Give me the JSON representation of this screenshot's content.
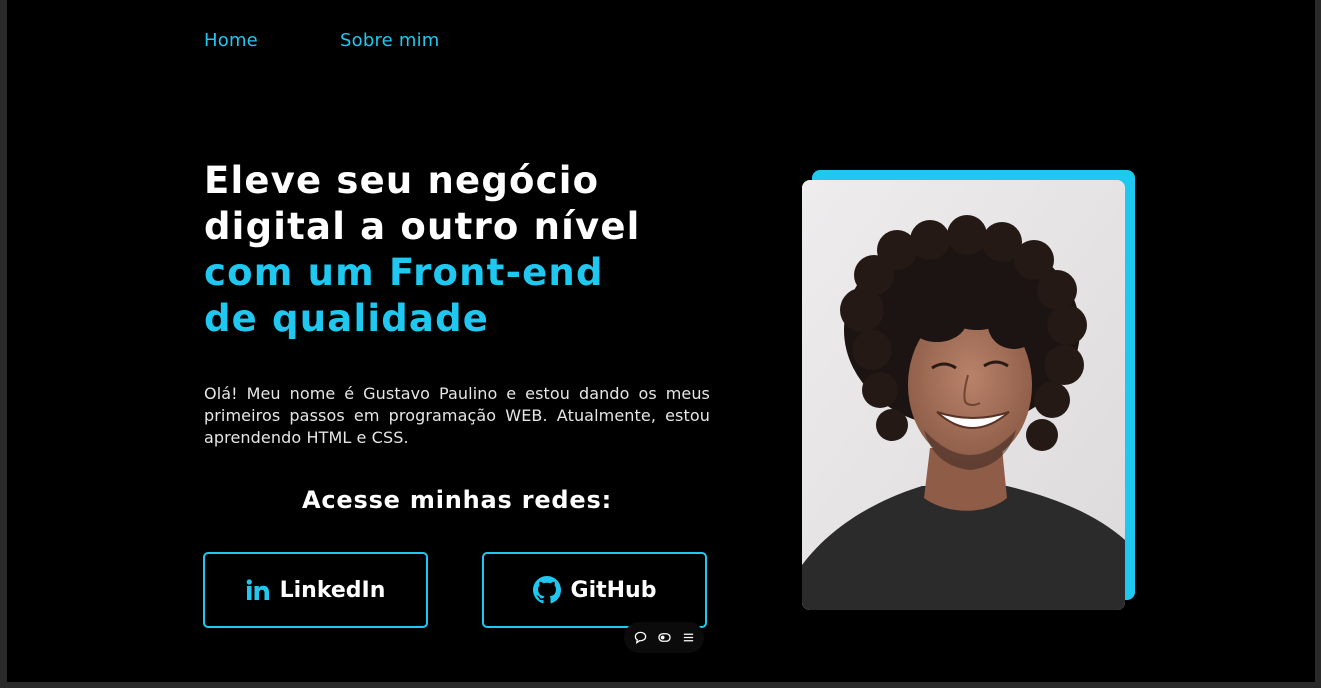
{
  "nav": {
    "home_label": "Home",
    "about_label": "Sobre mim"
  },
  "hero": {
    "headline_line1": "Eleve seu negócio",
    "headline_line2": "digital a outro nível",
    "headline_line3": "com um Front-end",
    "headline_line4": "de qualidade",
    "intro": "Olá! Meu nome é Gustavo Paulino e estou dando os meus primeiros passos em programação WEB. Atualmente, estou aprendendo HTML e CSS.",
    "networks_title": "Acesse minhas redes:"
  },
  "social": {
    "linkedin_label": "LinkedIn",
    "linkedin_icon": "linkedin-icon",
    "github_label": "GitHub",
    "github_icon": "github-icon"
  },
  "photo": {
    "subject": "profile-photo"
  },
  "floating_toolbar": {
    "icons": [
      "comment-icon",
      "toggle-icon",
      "menu-icon"
    ]
  },
  "colors": {
    "accent": "#1fc8f0",
    "background": "#000000",
    "text": "#ffffff"
  }
}
